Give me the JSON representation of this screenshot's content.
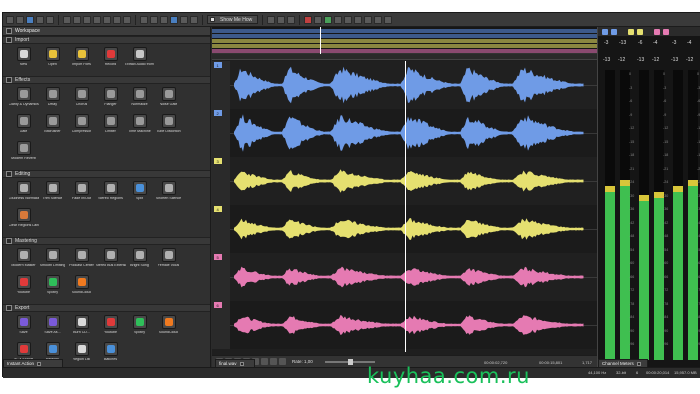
{
  "toolbar": {
    "show_me_how_label": "Show Me How"
  },
  "workspace": {
    "title": "Workspace"
  },
  "sections": [
    {
      "title": "Import",
      "items": [
        {
          "label": "New",
          "icon": "new-file-icon",
          "color": "#d9d9d9"
        },
        {
          "label": "Open",
          "icon": "folder-icon",
          "color": "#e8c23a"
        },
        {
          "label": "Import Files",
          "icon": "import-files-icon",
          "color": "#e8c23a"
        },
        {
          "label": "Record",
          "icon": "record-icon",
          "color": "#e03a3a"
        },
        {
          "label": "Extract Audio from CD",
          "icon": "cd-icon",
          "color": "#c8c8c8"
        }
      ]
    },
    {
      "title": "Effects",
      "items": [
        {
          "label": "Clarity & Dynamics",
          "icon": "clarity-icon",
          "color": "#9a9a9a"
        },
        {
          "label": "Delay",
          "icon": "delay-icon",
          "color": "#9a9a9a"
        },
        {
          "label": "Chorus",
          "icon": "chorus-icon",
          "color": "#9a9a9a"
        },
        {
          "label": "Flanger",
          "icon": "flanger-icon",
          "color": "#9a9a9a"
        },
        {
          "label": "Normalize",
          "icon": "normalize-icon",
          "color": "#9a9a9a"
        },
        {
          "label": "Noise Gate",
          "icon": "noise-gate-icon",
          "color": "#9a9a9a"
        },
        {
          "label": "Gate",
          "icon": "gate-icon",
          "color": "#9a9a9a"
        },
        {
          "label": "Bitcrusher",
          "icon": "bitcrusher-icon",
          "color": "#9a9a9a"
        },
        {
          "label": "Compressor",
          "icon": "compressor-icon",
          "color": "#9a9a9a"
        },
        {
          "label": "Limiter",
          "icon": "limiter-icon",
          "color": "#9a9a9a"
        },
        {
          "label": "Time Machine",
          "icon": "time-machine-icon",
          "color": "#9a9a9a"
        },
        {
          "label": "Tube Distortion",
          "icon": "tube-distortion-icon",
          "color": "#9a9a9a"
        },
        {
          "label": "Modern Reverb",
          "icon": "reverb-icon",
          "color": "#9a9a9a"
        }
      ]
    },
    {
      "title": "Editing",
      "items": [
        {
          "label": "Loudness Normalize",
          "icon": "loudness-icon",
          "color": "#b0b0b0"
        },
        {
          "label": "Trim Silence",
          "icon": "trim-silence-icon",
          "color": "#b0b0b0"
        },
        {
          "label": "Fade In/Out",
          "icon": "fade-icon",
          "color": "#b0b0b0"
        },
        {
          "label": "Stereo Regions",
          "icon": "stereo-regions-icon",
          "color": "#b0b0b0"
        },
        {
          "label": "Split",
          "icon": "split-icon",
          "color": "#4a90d9"
        },
        {
          "label": "Shorten Silence",
          "icon": "shorten-silence-icon",
          "color": "#b0b0b0"
        },
        {
          "label": "Clear Regions Lanes",
          "icon": "clear-regions-icon",
          "color": "#d97a3a"
        }
      ]
    },
    {
      "title": "Mastering",
      "items": [
        {
          "label": "Modern Master",
          "icon": "master-icon",
          "color": "#b0b0b0"
        },
        {
          "label": "Smooth Limiting",
          "icon": "limiting-icon",
          "color": "#b0b0b0"
        },
        {
          "label": "Podcast Center",
          "icon": "podcast-icon",
          "color": "#b0b0b0"
        },
        {
          "label": "Stereo Bus Extension",
          "icon": "stereo-bus-icon",
          "color": "#b0b0b0"
        },
        {
          "label": "Bright Song",
          "icon": "bright-song-icon",
          "color": "#b0b0b0"
        },
        {
          "label": "Female Vocal",
          "icon": "female-vocal-icon",
          "color": "#b0b0b0"
        },
        {
          "label": "Youtube",
          "icon": "youtube-icon",
          "color": "#e03a3a"
        },
        {
          "label": "Spotify",
          "icon": "spotify-icon",
          "color": "#2fbf5a"
        },
        {
          "label": "SoundCloud",
          "icon": "soundcloud-icon",
          "color": "#f07a20"
        }
      ]
    },
    {
      "title": "Export",
      "items": [
        {
          "label": "Save",
          "icon": "save-icon",
          "color": "#7a5ad9"
        },
        {
          "label": "Save As...",
          "icon": "save-as-icon",
          "color": "#7a5ad9"
        },
        {
          "label": "Burn CD...",
          "icon": "burn-cd-icon",
          "color": "#d9d9d9"
        },
        {
          "label": "Youtube",
          "icon": "youtube-icon",
          "color": "#e03a3a"
        },
        {
          "label": "Spotify",
          "icon": "spotify-icon",
          "color": "#2fbf5a"
        },
        {
          "label": "SoundCloud",
          "icon": "soundcloud-icon",
          "color": "#f07a20"
        },
        {
          "label": "ACX Export",
          "icon": "acx-icon",
          "color": "#e03a3a"
        },
        {
          "label": "Regions",
          "icon": "regions-icon",
          "color": "#4a90d9"
        },
        {
          "label": "Region List",
          "icon": "region-list-icon",
          "color": "#d9d9d9"
        },
        {
          "label": "Batches",
          "icon": "batches-icon",
          "color": "#4a90d9"
        }
      ]
    }
  ],
  "bottom_tabs": {
    "instant_action": "Instant Action",
    "final_wav": "final.wav",
    "channel_meters": "Channel Meters"
  },
  "transport": {
    "rate_label": "Rate: 1,00"
  },
  "wave_times": {
    "sel_start": "00:00:02,720",
    "sel_end": "00:00:15,801",
    "sel_len": "1,717"
  },
  "tracks": [
    {
      "num": "1",
      "color": "#6f9be6"
    },
    {
      "num": "2",
      "color": "#6f9be6"
    },
    {
      "num": "3",
      "color": "#e5e070"
    },
    {
      "num": "4",
      "color": "#e5e070"
    },
    {
      "num": "5",
      "color": "#e57ab2"
    },
    {
      "num": "6",
      "color": "#e57ab2"
    }
  ],
  "meters": {
    "peaks": [
      "-3",
      "-13",
      "-6",
      "-4",
      "-3",
      "-4"
    ],
    "peaks2": [
      "-13",
      "-12",
      "-13",
      "-12",
      "-13",
      "-12"
    ],
    "scale": [
      "0",
      "-3",
      "-6",
      "-9",
      "-12",
      "-15",
      "-18",
      "-21",
      "-24",
      "-30",
      "-36",
      "-42",
      "-48",
      "-54",
      "-60",
      "-66",
      "-72",
      "-78",
      "-84",
      "-90",
      "-96"
    ],
    "levels": [
      0.58,
      0.6,
      0.55,
      0.56,
      0.58,
      0.6
    ]
  },
  "status": {
    "sample_rate": "44,100 Hz",
    "bits": "32-bit",
    "channels": "6",
    "time1": "00:00:20,014",
    "time2": "15,957.0 MB"
  },
  "watermark": "kuyhaa.com.ru"
}
